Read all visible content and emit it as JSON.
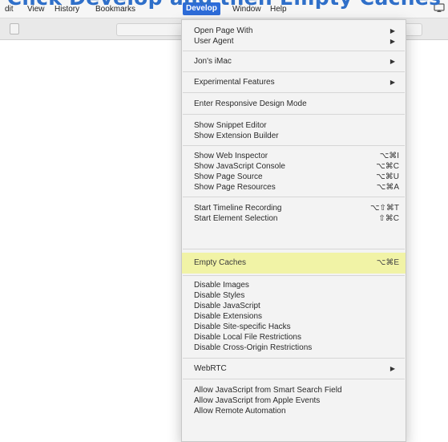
{
  "caption": "Click Develop and then Empty Caches",
  "menubar": {
    "items": [
      "dit",
      "View",
      "History",
      "Bookmarks",
      "Develop",
      "Window",
      "Help"
    ],
    "active_index": 4,
    "right_icon": "screen-mirroring-icon"
  },
  "menu": {
    "open_page_with": "Open Page With",
    "user_agent": "User Agent",
    "device": "Jon's iMac",
    "experimental": "Experimental Features",
    "responsive": "Enter Responsive Design Mode",
    "snippet_editor": "Show Snippet Editor",
    "extension_builder": "Show Extension Builder",
    "web_inspector": {
      "label": "Show Web Inspector",
      "shortcut": "⌥⌘I"
    },
    "js_console": {
      "label": "Show JavaScript Console",
      "shortcut": "⌥⌘C"
    },
    "page_source": {
      "label": "Show Page Source",
      "shortcut": "⌥⌘U"
    },
    "page_resources": {
      "label": "Show Page Resources",
      "shortcut": "⌥⌘A"
    },
    "timeline": {
      "label": "Start Timeline Recording",
      "shortcut": "⌥⇧⌘T"
    },
    "element_selection": {
      "label": "Start Element Selection",
      "shortcut": "⇧⌘C"
    },
    "empty_caches": {
      "label": "Empty Caches",
      "shortcut": "⌥⌘E"
    },
    "disable_images": "Disable Images",
    "disable_styles": "Disable Styles",
    "disable_js": "Disable JavaScript",
    "disable_extensions": "Disable Extensions",
    "disable_site_hacks": "Disable Site-specific Hacks",
    "disable_local_files": "Disable Local File Restrictions",
    "disable_cors": "Disable Cross-Origin Restrictions",
    "webrtc": "WebRTC",
    "allow_js_search": "Allow JavaScript from Smart Search Field",
    "allow_js_apple_events": "Allow JavaScript from Apple Events",
    "allow_remote_automation": "Allow Remote Automation",
    "submenu_arrow": "▶"
  },
  "colors": {
    "highlight": "#f1f3a6",
    "menubar_active": "#2d6cd9",
    "caption": "#2f6fc9"
  }
}
